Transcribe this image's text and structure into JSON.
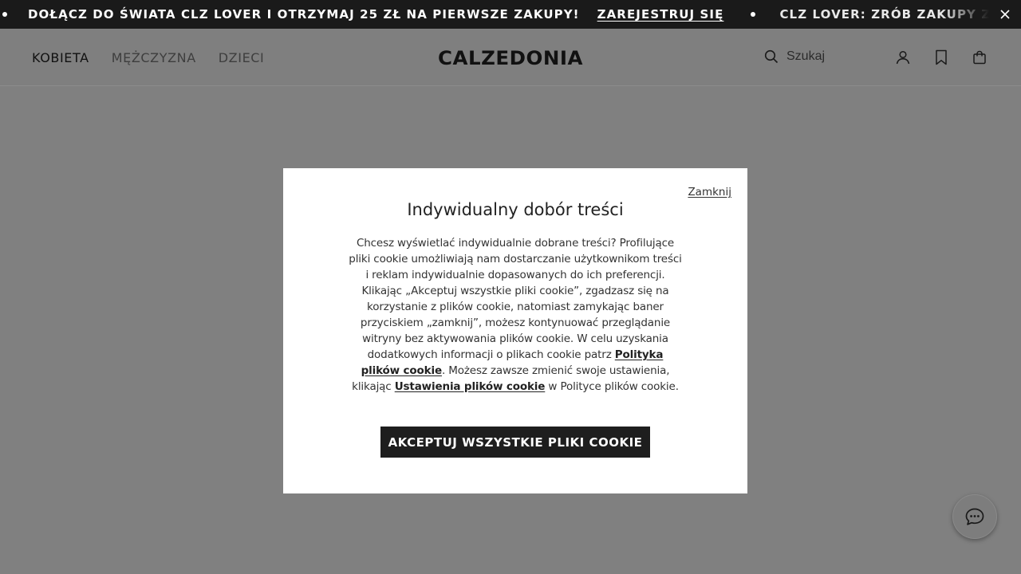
{
  "promo": {
    "message": "DOŁĄCZ DO ŚWIATA CLZ LOVER I OTRZYMAJ 25 ZŁ NA PIERWSZE ZAKUPY!",
    "link_label": "ZAREJESTRUJ SIĘ",
    "message_2": "CLZ LOVER: ZRÓB ZAKUPY Z",
    "close_icon": "close-icon"
  },
  "nav": {
    "items": [
      {
        "label": "KOBIETA",
        "active": true
      },
      {
        "label": "MĘŻCZYZNA",
        "active": false
      },
      {
        "label": "DZIECI",
        "active": false
      }
    ]
  },
  "brand": {
    "logo_text": "CALZEDONIA"
  },
  "search": {
    "placeholder": "Szukaj",
    "icon": "search-icon"
  },
  "header_icons": [
    "user-icon",
    "bookmark-icon",
    "bag-icon"
  ],
  "modal": {
    "close_label": "Zamknij",
    "title": "Indywidualny dobór treści",
    "body_part1": "Chcesz wyświetlać indywidualnie dobrane treści? Profilujące pliki cookie umożliwiają nam dostarczanie użytkownikom treści i reklam indywidualnie dopasowanych do ich preferencji. Klikając „Akceptuj wszystkie pliki cookie”, zgadzasz się na korzystanie z plików cookie, natomiast zamykając baner przyciskiem „zamknij”, możesz kontynuować przeglądanie witryny bez aktywowania plików cookie. W celu uzyskania dodatkowych informacji o plikach cookie patrz ",
    "policy_link": "Polityka plików cookie",
    "body_part2": ". Możesz zawsze zmienić swoje ustawienia, klikając ",
    "settings_link": "Ustawienia plików cookie",
    "body_part3": " w Polityce plików cookie.",
    "accept_label": "AKCEPTUJ WSZYSTKIE PLIKI COOKIE"
  },
  "chat": {
    "icon": "chat-bubble-icon"
  }
}
